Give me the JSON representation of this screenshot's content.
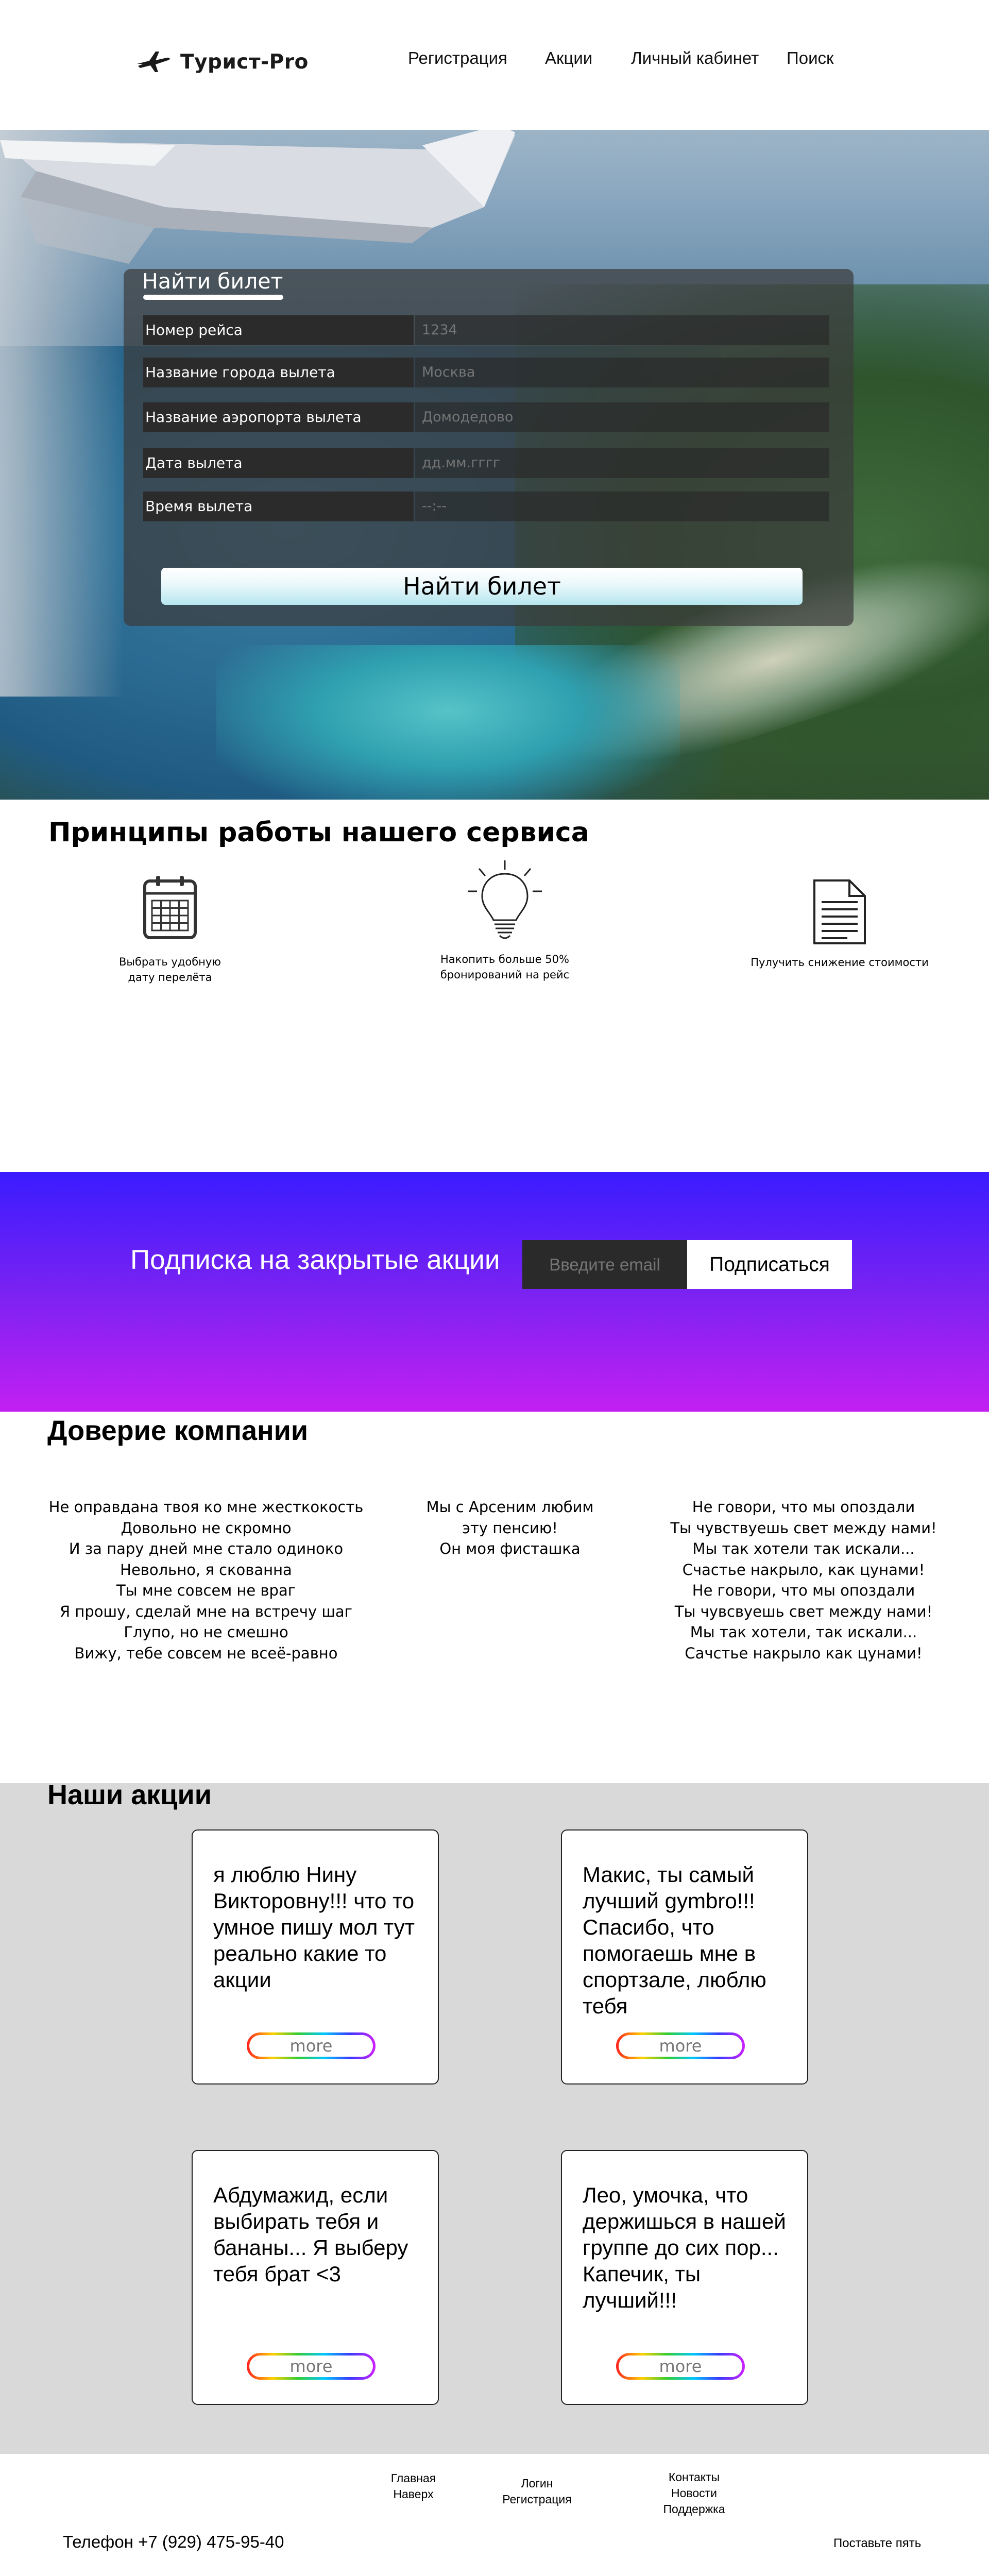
{
  "header": {
    "logo_text": "Турист-Pro",
    "nav": [
      "Регистрация",
      "Акции",
      "Личный кабинет",
      "Поиск"
    ]
  },
  "ticket_form": {
    "title": "Найти билет",
    "fields": [
      {
        "label": "Номер рейса",
        "placeholder": "1234"
      },
      {
        "label": "Название города вылета",
        "placeholder": "Москва"
      },
      {
        "label": "Название аэропорта вылета",
        "placeholder": "Домодедово"
      },
      {
        "label": "Дата вылета",
        "placeholder": "дд.мм.гггг"
      },
      {
        "label": "Время вылета",
        "placeholder": "--:--"
      }
    ],
    "submit_label": "Найти билет"
  },
  "principles": {
    "title": "Принципы работы нашего сервиса",
    "items": [
      {
        "icon": "calendar-icon",
        "line1": "Выбрать удобную",
        "line2": "дату перелёта"
      },
      {
        "icon": "lightbulb-icon",
        "line1": "Накопить больше 50%",
        "line2": "бронирований на рейс"
      },
      {
        "icon": "document-icon",
        "line1": "Пулучить снижение стоимости",
        "line2": ""
      }
    ]
  },
  "subscribe": {
    "title": "Подписка на закрытые акции",
    "email_placeholder": "Введите email",
    "button_label": "Подписаться"
  },
  "trust": {
    "title": "Доверие компании",
    "columns": [
      [
        "Не оправдана твоя ко мне жесткокость",
        "Довольно не скромно",
        "И за пару дней мне стало одиноко",
        "Невольно, я скованна",
        "Ты мне совсем не враг",
        "Я прошу, сделай мне на встречу шаг",
        "Глупо, но не смешно",
        "Вижу, тебе совсем не всеё-равно"
      ],
      [
        "Мы с Арсеним любим",
        "эту пенсию!",
        "Он моя фисташка"
      ],
      [
        "Не говори, что мы опоздали",
        "Ты чувствуешь свет между нами!",
        "Мы так хотели так искали...",
        "Счастье накрыло, как цунами!",
        "Не говори, что мы опоздали",
        "Ты чувсвуешь свет между нами!",
        "Мы так хотели, так искали...",
        "Сачстье накрыло как цунами!"
      ]
    ]
  },
  "promos": {
    "title": "Наши акции",
    "cards": [
      {
        "text": "я люблю Нину Викторовну!!! что то умное пишу мол тут реально какие то акции",
        "more": "more"
      },
      {
        "text": "Макис, ты самый лучший gymbro!!! Спасибо, что помогаешь мне в спортзале, люблю тебя",
        "more": "more"
      },
      {
        "text": "Абдумажид, если выбирать тебя и бананы... Я выберу тебя брат <3",
        "more": "more"
      },
      {
        "text": "Лео, умочка, что держишься в нашей группе до сих пор... Капечик, ты лучший!!!",
        "more": "more"
      }
    ]
  },
  "footer": {
    "col1": [
      "Главная",
      "Наверх"
    ],
    "col2": [
      "Логин",
      "Регистрация"
    ],
    "col3": [
      "Контакты",
      "Новости",
      "Поддержка"
    ],
    "phone": "Телефон +7 (929) 475-95-40",
    "rate": "Поставьте пять"
  }
}
